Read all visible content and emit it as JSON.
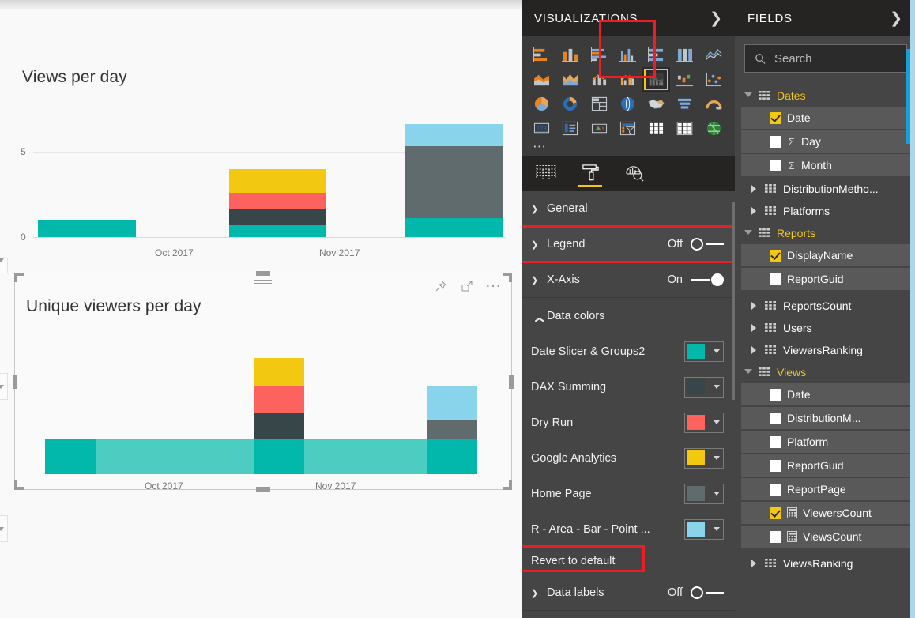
{
  "canvas": {
    "visuals": [
      {
        "title": "Views per day",
        "tools": [
          "pin-icon",
          "focus-mode-icon",
          "more-options-icon"
        ]
      },
      {
        "title": "Unique viewers per day",
        "tools": [
          "pin-icon",
          "focus-mode-icon",
          "more-options-icon"
        ]
      }
    ]
  },
  "chart_data": [
    {
      "type": "bar",
      "title": "Views per day",
      "stacked": true,
      "categories": [
        "Oct 2017",
        "Nov 2017"
      ],
      "x_tick_labels": [
        "Oct 2017",
        "Nov 2017"
      ],
      "ytick_labels": [
        "0",
        "5"
      ],
      "ylim": [
        0,
        7.5
      ],
      "ylabel": "",
      "xlabel": "",
      "grid": true,
      "legend": "off",
      "bars": [
        {
          "x_position": 0.18,
          "segments": [
            {
              "name": "Date Slicer & Groups2",
              "color": "#01B8AA",
              "value": 1
            }
          ]
        },
        {
          "x_position": 0.52,
          "segments": [
            {
              "name": "Date Slicer & Groups2",
              "color": "#01B8AA",
              "value": 1
            },
            {
              "name": "DAX Summing",
              "color": "#374649",
              "value": 1
            },
            {
              "name": "Dry Run",
              "color": "#FD625E",
              "value": 1
            },
            {
              "name": "Google Analytics",
              "color": "#F2C811",
              "value": 1
            }
          ]
        },
        {
          "x_position": 0.85,
          "segments": [
            {
              "name": "Date Slicer & Groups2",
              "color": "#01B8AA",
              "value": 1
            },
            {
              "name": "Home Page",
              "color": "#5F6B6D",
              "value": 5
            },
            {
              "name": "R - Area - Bar - Point ...",
              "color": "#8AD4EB",
              "value": 1
            }
          ]
        }
      ]
    },
    {
      "type": "bar",
      "title": "Unique viewers per day",
      "stacked": true,
      "categories": [
        "Oct 2017",
        "Nov 2017"
      ],
      "x_tick_labels": [
        "Oct 2017",
        "Nov 2017"
      ],
      "ylim": [
        0,
        5
      ],
      "ylabel": "",
      "xlabel": "",
      "grid": false,
      "legend": "off",
      "baseline_band": {
        "color_active": "#01B8AA",
        "color_faded": "#4DCCC2"
      },
      "bars": [
        {
          "x_position": 0.02,
          "segments": [
            {
              "name": "Date Slicer & Groups2",
              "color": "#01B8AA",
              "value": 1
            }
          ]
        },
        {
          "x_position": 0.48,
          "segments": [
            {
              "name": "Date Slicer & Groups2",
              "color": "#01B8AA",
              "value": 1
            },
            {
              "name": "DAX Summing",
              "color": "#374649",
              "value": 1
            },
            {
              "name": "Dry Run",
              "color": "#FD625E",
              "value": 1
            },
            {
              "name": "Google Analytics",
              "color": "#F2C811",
              "value": 1
            }
          ]
        },
        {
          "x_position": 0.95,
          "segments": [
            {
              "name": "Date Slicer & Groups2",
              "color": "#01B8AA",
              "value": 1
            },
            {
              "name": "Home Page",
              "color": "#5F6B6D",
              "value": 1
            },
            {
              "name": "R - Area - Bar - Point ...",
              "color": "#8AD4EB",
              "value": 1
            }
          ]
        }
      ]
    }
  ],
  "visualizations_pane": {
    "title": "VISUALIZATIONS",
    "collapse_icon": "chevron-right-icon",
    "gallery_icons": [
      "stacked-bar-chart",
      "stacked-column-chart",
      "clustered-bar-chart",
      "clustered-column-chart",
      "100-percent-stacked-bar-chart",
      "100-percent-stacked-column-chart",
      "line-chart",
      "area-chart",
      "stacked-area-chart",
      "line-and-stacked-column-chart",
      "line-and-clustered-column-chart",
      "ribbon-chart",
      "waterfall-chart",
      "scatter-chart",
      "pie-chart",
      "donut-chart",
      "treemap",
      "map",
      "filled-map",
      "funnel",
      "gauge",
      "card",
      "multi-row-card",
      "kpi",
      "slicer",
      "table",
      "matrix",
      "r-script-visual"
    ],
    "selected_icon": "ribbon-chart",
    "more_icon": "ellipsis-icon",
    "tabs": [
      {
        "name": "fields-tab",
        "icon": "fields-grid-icon",
        "active": false
      },
      {
        "name": "format-tab",
        "icon": "paint-roller-icon",
        "active": true
      },
      {
        "name": "analytics-tab",
        "icon": "analytics-magnifier-icon",
        "active": false
      }
    ],
    "sections": [
      {
        "label": "General",
        "state": null,
        "expanded": false
      },
      {
        "label": "Legend",
        "state": "Off",
        "expanded": false,
        "toggle": "off",
        "highlighted": true
      },
      {
        "label": "X-Axis",
        "state": "On",
        "expanded": false,
        "toggle": "on"
      },
      {
        "label": "Data colors",
        "state": null,
        "expanded": true
      }
    ],
    "data_colors": [
      {
        "label": "Date Slicer & Groups2",
        "color": "#01B8AA"
      },
      {
        "label": "DAX Summing",
        "color": "#374649"
      },
      {
        "label": "Dry Run",
        "color": "#FD625E"
      },
      {
        "label": "Google Analytics",
        "color": "#F2C811"
      },
      {
        "label": "Home Page",
        "color": "#5F6B6D"
      },
      {
        "label": "R - Area - Bar - Point ...",
        "color": "#8AD4EB"
      }
    ],
    "revert_label": "Revert to default",
    "revert_highlighted": true,
    "footer_section": {
      "label": "Data labels",
      "state": "Off",
      "toggle": "off"
    }
  },
  "fields_pane": {
    "title": "FIELDS",
    "collapse_icon": "chevron-right-icon",
    "search": {
      "placeholder": "Search",
      "value": "",
      "icon": "search-icon"
    },
    "tree": [
      {
        "type": "table",
        "label": "Dates",
        "expanded": true
      },
      {
        "type": "field",
        "label": "Date",
        "checked": true,
        "measure": false
      },
      {
        "type": "field",
        "label": "Day",
        "checked": false,
        "measure": true
      },
      {
        "type": "field",
        "label": "Month",
        "checked": false,
        "measure": true
      },
      {
        "type": "table",
        "label": "DistributionMetho...",
        "expanded": false
      },
      {
        "type": "table",
        "label": "Platforms",
        "expanded": false
      },
      {
        "type": "table",
        "label": "Reports",
        "expanded": true
      },
      {
        "type": "field",
        "label": "DisplayName",
        "checked": true,
        "measure": false
      },
      {
        "type": "field",
        "label": "ReportGuid",
        "checked": false,
        "measure": false
      },
      {
        "type": "table",
        "label": "ReportsCount",
        "expanded": false
      },
      {
        "type": "table",
        "label": "Users",
        "expanded": false
      },
      {
        "type": "table",
        "label": "ViewersRanking",
        "expanded": false
      },
      {
        "type": "table",
        "label": "Views",
        "expanded": true
      },
      {
        "type": "field",
        "label": "Date",
        "checked": false,
        "measure": false
      },
      {
        "type": "field",
        "label": "DistributionM...",
        "checked": false,
        "measure": false
      },
      {
        "type": "field",
        "label": "Platform",
        "checked": false,
        "measure": false
      },
      {
        "type": "field",
        "label": "ReportGuid",
        "checked": false,
        "measure": false
      },
      {
        "type": "field",
        "label": "ReportPage",
        "checked": false,
        "measure": false
      },
      {
        "type": "field",
        "label": "ViewersCount",
        "checked": true,
        "calc": true
      },
      {
        "type": "field",
        "label": "ViewsCount",
        "checked": false,
        "calc": true
      },
      {
        "type": "table",
        "label": "ViewsRanking",
        "expanded": false
      }
    ]
  },
  "colors": {
    "accent_yellow": "#F2C811",
    "annotation_red": "#EE1C25",
    "pane_bg": "#454545",
    "pane_header_bg": "#252423",
    "canvas_bg": "#F9F9F9"
  }
}
